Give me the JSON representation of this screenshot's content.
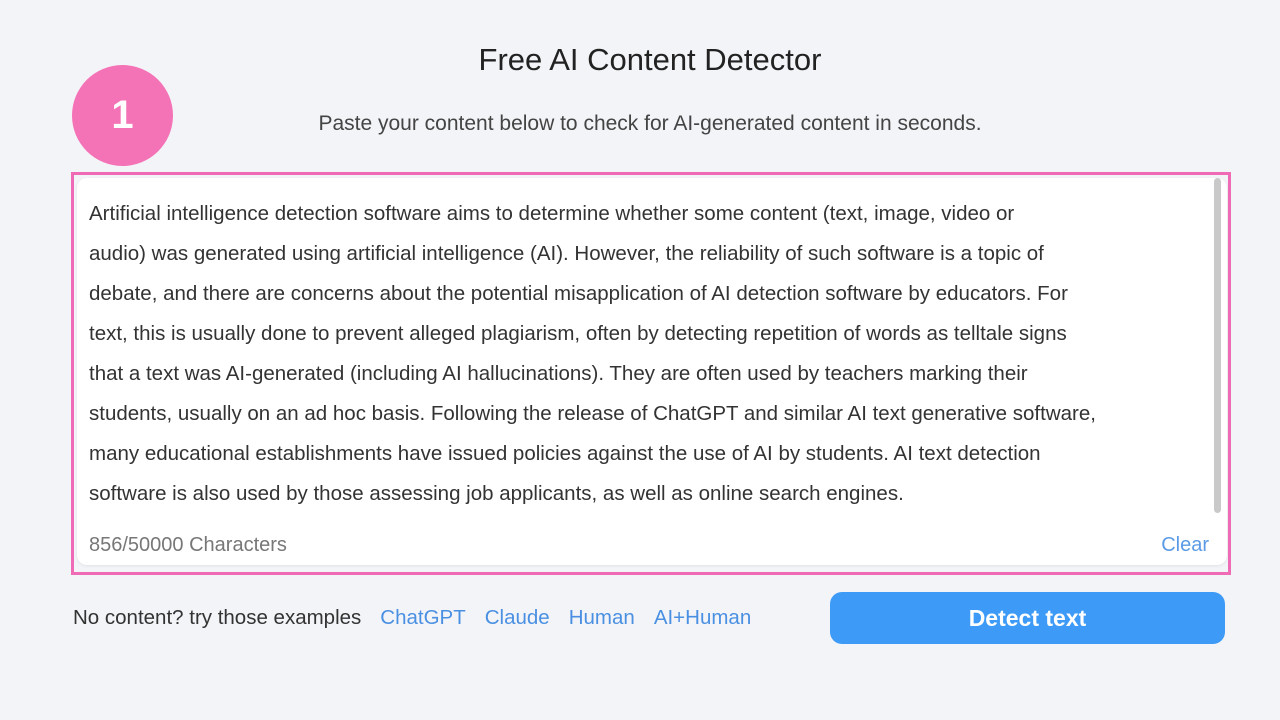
{
  "header": {
    "title": "Free AI Content Detector",
    "subtitle": "Paste your content below to check for AI-generated content in seconds."
  },
  "annotation": {
    "step_number": "1",
    "color": "#f472b6"
  },
  "editor": {
    "lines": [
      "Artificial intelligence detection software aims to determine whether some content (text, image, video or",
      "audio) was generated using artificial intelligence (AI). However, the reliability of such software is a topic of",
      "debate, and there are concerns about the potential misapplication of AI detection software by educators. For",
      "text, this is usually done to prevent alleged plagiarism, often by detecting repetition of words as telltale signs",
      "that a text was AI-generated (including AI hallucinations). They are often used by teachers marking their",
      "students, usually on an ad hoc basis. Following the release of ChatGPT and similar AI text generative software,",
      "many educational establishments have issued policies against the use of AI by students. AI text detection",
      "software is also used by those assessing job applicants, as well as online search engines."
    ],
    "char_count": "856/50000 Characters",
    "clear_label": "Clear"
  },
  "examples": {
    "label": "No content? try those examples",
    "items": [
      "ChatGPT",
      "Claude",
      "Human",
      "AI+Human"
    ]
  },
  "detect_button": {
    "label": "Detect text",
    "color": "#3d9bf7"
  }
}
